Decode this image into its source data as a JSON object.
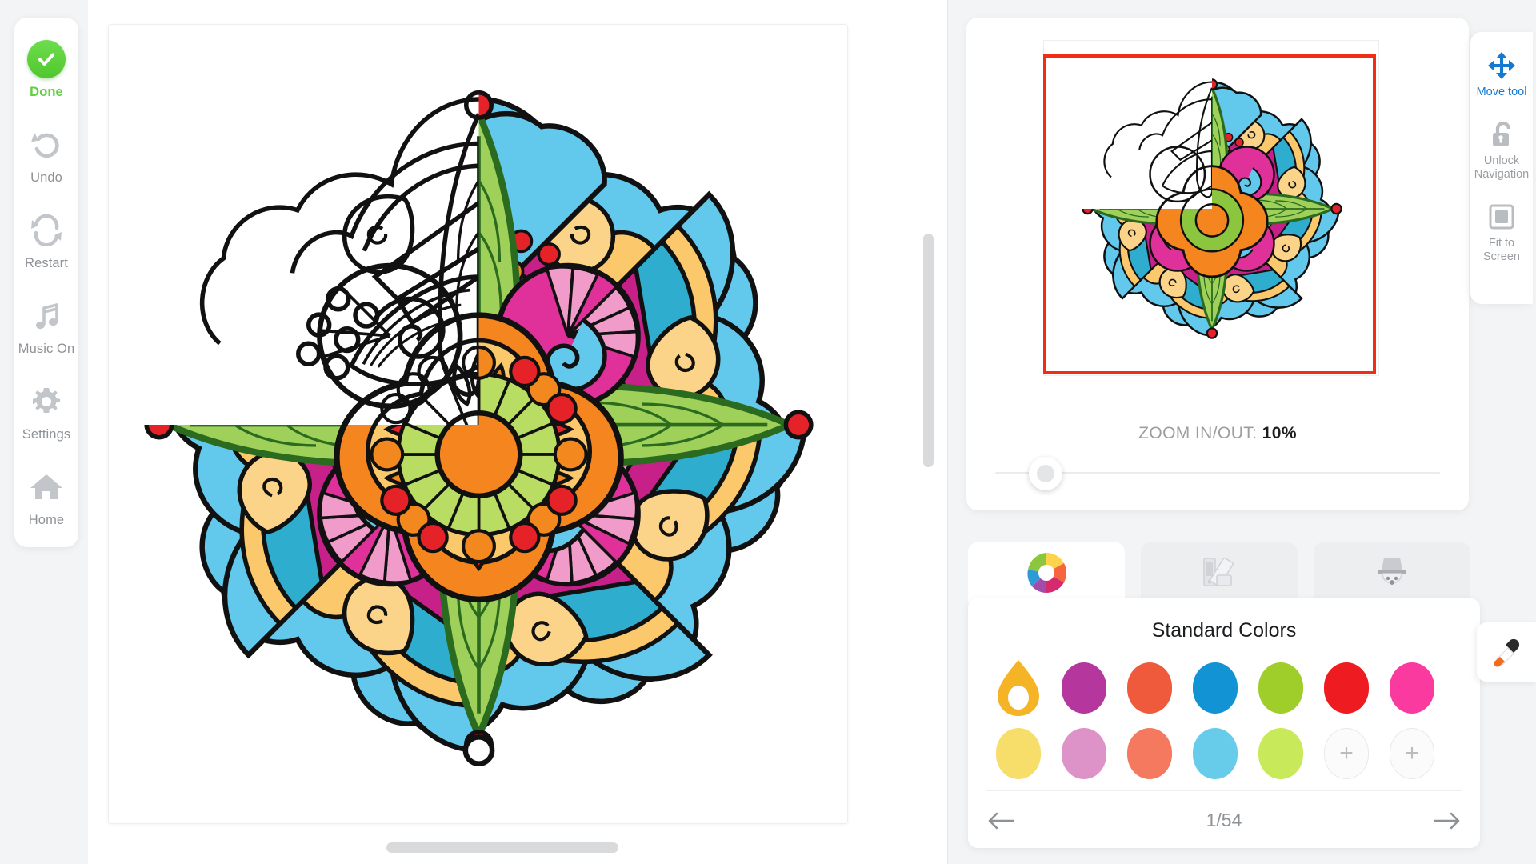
{
  "app": {
    "background": "#f2f4f6",
    "accent_blue": "#1479d1",
    "done_green": "#5DD13E",
    "viewport_frame_color": "#F32C14"
  },
  "left_toolbar": {
    "items": [
      {
        "id": "done",
        "label": "Done",
        "icon": "check-circle-icon"
      },
      {
        "id": "undo",
        "label": "Undo",
        "icon": "undo-arrow-icon"
      },
      {
        "id": "restart",
        "label": "Restart",
        "icon": "restart-arrows-icon"
      },
      {
        "id": "music",
        "label": "Music On",
        "icon": "music-note-icon"
      },
      {
        "id": "settings",
        "label": "Settings",
        "icon": "gear-icon"
      },
      {
        "id": "home",
        "label": "Home",
        "icon": "home-icon"
      }
    ]
  },
  "canvas": {
    "artwork_name": "mandala-flower",
    "coloring_state": "partially-colored",
    "uncolored_region": "upper-left"
  },
  "navigator": {
    "zoom_prefix": "ZOOM IN/OUT:",
    "zoom_value": "10%",
    "slider_position_percent": 10
  },
  "right_toolbar": {
    "items": [
      {
        "id": "move",
        "label": "Move tool",
        "icon": "move-arrows-icon",
        "active": true
      },
      {
        "id": "unlock",
        "label": "Unlock\nNavigation",
        "label_line1": "Unlock",
        "label_line2": "Navigation",
        "icon": "unlock-padlock-icon",
        "active": false
      },
      {
        "id": "fit",
        "label": "Fit to\nScreen",
        "label_line1": "Fit to",
        "label_line2": "Screen",
        "icon": "fit-to-screen-icon",
        "active": false
      }
    ]
  },
  "palette": {
    "tabs": [
      {
        "id": "colors",
        "icon": "color-wheel-icon",
        "active": true
      },
      {
        "id": "palettes",
        "icon": "swatch-fan-icon",
        "active": false
      },
      {
        "id": "mascot",
        "icon": "top-hat-face-icon",
        "active": false
      }
    ],
    "title": "Standard Colors",
    "selected_index": 0,
    "rows": [
      [
        {
          "hex": "#F5B425",
          "selected": true
        },
        {
          "hex": "#B5379E",
          "selected": false
        },
        {
          "hex": "#F05A3C",
          "selected": false
        },
        {
          "hex": "#1193D4",
          "selected": false
        },
        {
          "hex": "#9FCE2A",
          "selected": false
        },
        {
          "hex": "#EE1C20",
          "selected": false
        },
        {
          "hex": "#FA3A9E",
          "selected": false
        }
      ],
      [
        {
          "hex": "#F7DE6A",
          "selected": false
        },
        {
          "hex": "#DD93C8",
          "selected": false
        },
        {
          "hex": "#F5795E",
          "selected": false
        },
        {
          "hex": "#67CCEA",
          "selected": false
        },
        {
          "hex": "#C8E95A",
          "selected": false
        },
        {
          "hex": "",
          "selected": false,
          "add": true,
          "add_label": "+"
        },
        {
          "hex": "",
          "selected": false,
          "add": true,
          "add_label": "+"
        }
      ]
    ],
    "pagination": {
      "current": 1,
      "total": 54,
      "text": "1/54",
      "prev_icon": "arrow-left-icon",
      "next_icon": "arrow-right-icon"
    }
  },
  "eyedropper": {
    "icon": "eyedropper-icon",
    "tip_color": "#F26B1F"
  }
}
